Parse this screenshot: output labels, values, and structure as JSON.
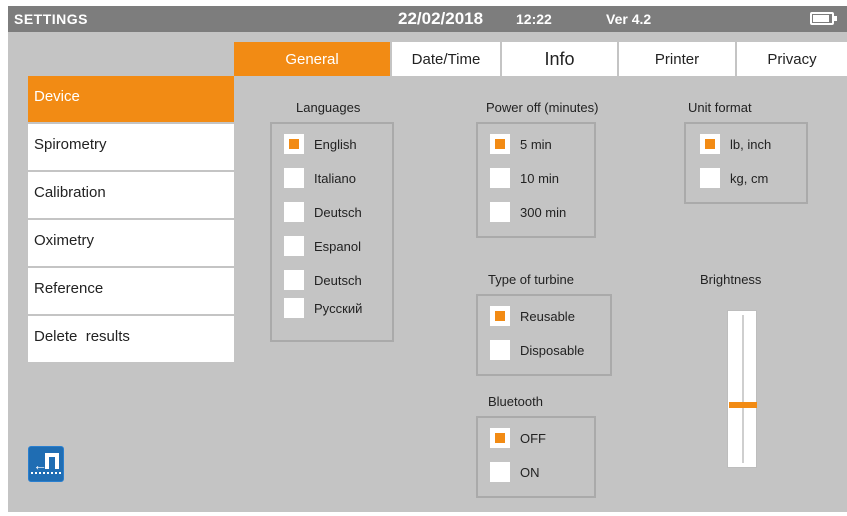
{
  "header": {
    "title": "SETTINGS",
    "date": "22/02/2018",
    "time": "12:22",
    "version": "Ver 4.2",
    "battery_icon": "battery-icon"
  },
  "tabs": [
    {
      "label": "General",
      "active": true
    },
    {
      "label": "Date/Time",
      "active": false
    },
    {
      "label": "Info",
      "active": false
    },
    {
      "label": "Printer",
      "active": false
    },
    {
      "label": "Privacy",
      "active": false
    }
  ],
  "menu": [
    {
      "label": "Device",
      "active": true
    },
    {
      "label": "Spirometry",
      "active": false
    },
    {
      "label": "Calibration",
      "active": false
    },
    {
      "label": "Oximetry",
      "active": false
    },
    {
      "label": "Reference",
      "active": false
    },
    {
      "label": "Delete  results",
      "active": false
    }
  ],
  "exit_icon": "exit-door-icon",
  "languages": {
    "label": "Languages",
    "options": [
      {
        "label": "English",
        "checked": true
      },
      {
        "label": "Italiano",
        "checked": false
      },
      {
        "label": "Deutsch",
        "checked": false
      },
      {
        "label": "Espanol",
        "checked": false
      },
      {
        "label": "Deutsch",
        "checked": false
      },
      {
        "label": "Pyccкий",
        "checked": false
      }
    ]
  },
  "power_off": {
    "label": "Power off (minutes)",
    "options": [
      {
        "label": "5 min",
        "checked": true
      },
      {
        "label": "10 min",
        "checked": false
      },
      {
        "label": "300 min",
        "checked": false
      }
    ]
  },
  "unit_format": {
    "label": "Unit format",
    "options": [
      {
        "label": "lb, inch",
        "checked": true
      },
      {
        "label": "kg, cm",
        "checked": false
      }
    ]
  },
  "turbine": {
    "label": "Type of turbine",
    "options": [
      {
        "label": "Reusable",
        "checked": true
      },
      {
        "label": "Disposable",
        "checked": false
      }
    ]
  },
  "bluetooth": {
    "label": "Bluetooth",
    "options": [
      {
        "label": "OFF",
        "checked": true
      },
      {
        "label": "ON",
        "checked": false
      }
    ]
  },
  "brightness": {
    "label": "Brightness",
    "level": 0.4
  },
  "colors": {
    "accent": "#f28b14",
    "header": "#7d7d7d",
    "background": "#c4c4c4",
    "exit_button": "#1f6db3"
  }
}
